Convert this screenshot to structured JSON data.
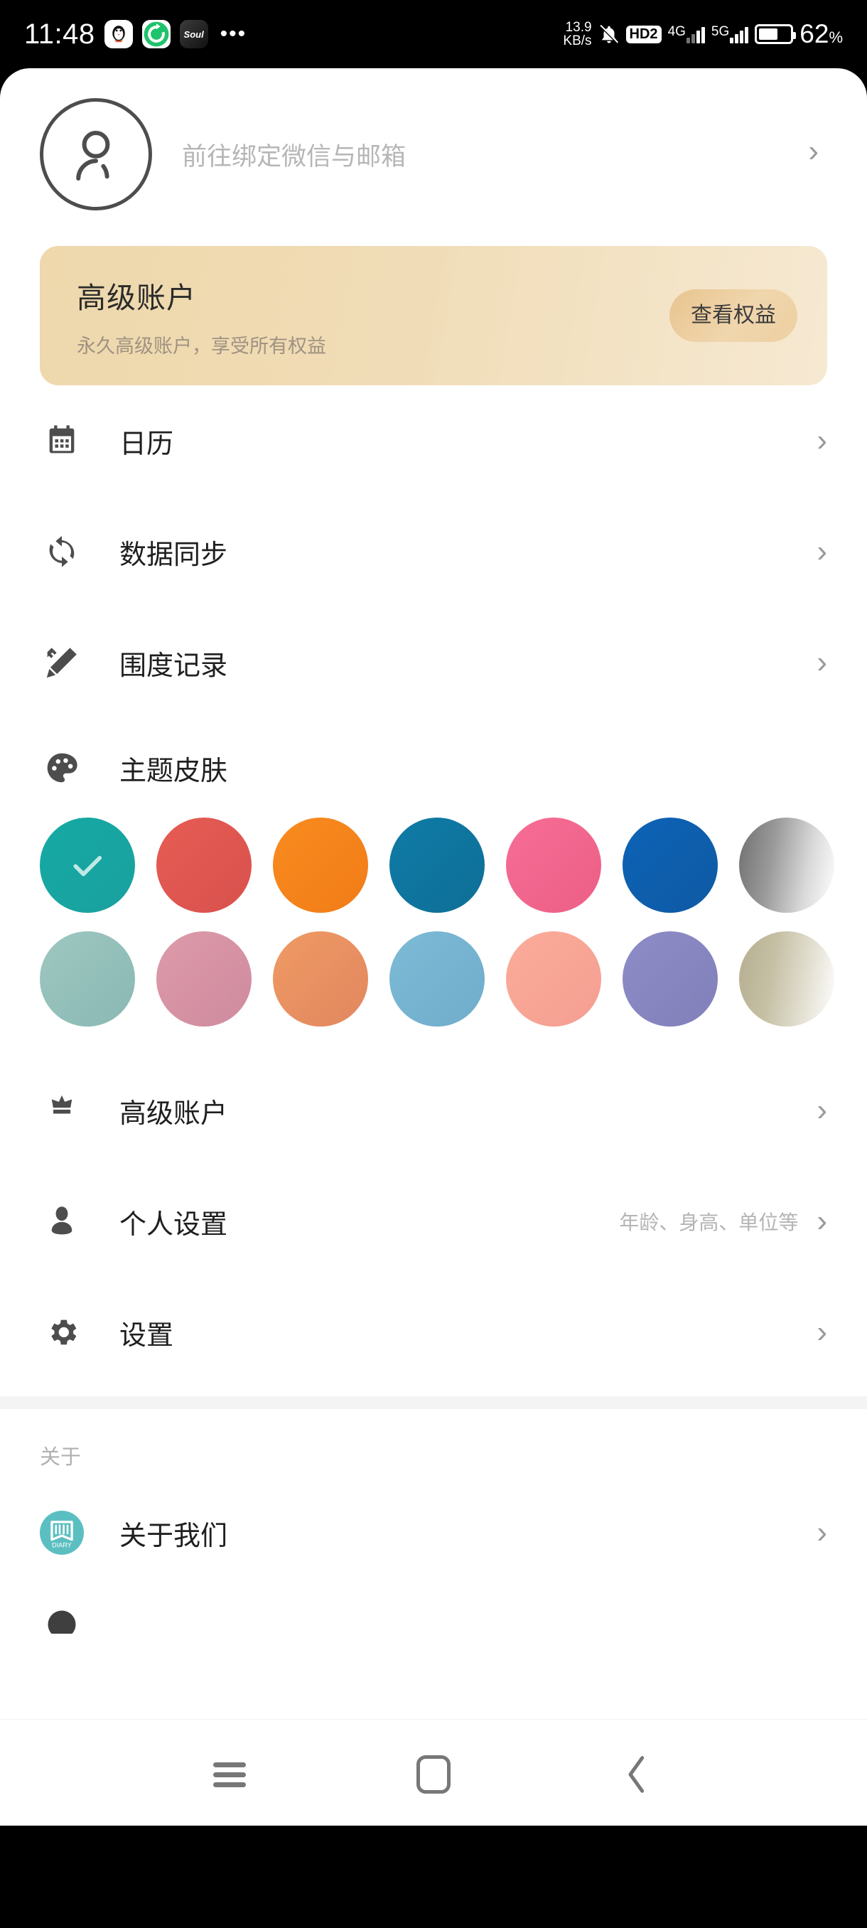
{
  "statusbar": {
    "time": "11:48",
    "app_icons": [
      "qq-icon",
      "sync-green-icon",
      "soul-icon"
    ],
    "soul_label": "Soul",
    "overflow": "•••",
    "network_speed_value": "13.9",
    "network_speed_unit": "KB/s",
    "mute_icon": "mute-bell-icon",
    "hd_badge": "HD2",
    "network_1": "4G",
    "network_2": "5G",
    "battery_percent": "62",
    "battery_unit": "%"
  },
  "profile": {
    "avatar_icon": "user-avatar-icon",
    "bind_text": "前往绑定微信与邮箱",
    "chevron": "›"
  },
  "premium_banner": {
    "title": "高级账户",
    "subtitle": "永久高级账户，享受所有权益",
    "button_label": "查看权益",
    "bg_color": "#EED8AC",
    "button_color": "#E8C48F"
  },
  "menu": [
    {
      "label": "日历",
      "icon": "calendar-icon",
      "hint": "",
      "chevron": "›"
    },
    {
      "label": "数据同步",
      "icon": "sync-icon",
      "hint": "",
      "chevron": "›"
    },
    {
      "label": "围度记录",
      "icon": "ruler-pencil-icon",
      "hint": "",
      "chevron": "›"
    },
    {
      "label": "主题皮肤",
      "icon": "palette-icon",
      "hint": "",
      "chevron": ""
    }
  ],
  "theme_swatches": {
    "selected_index": 0,
    "check_icon": "check-icon",
    "row1": [
      {
        "name": "teal",
        "color": "#14A5A5",
        "gradient": "linear-gradient(135deg,#16a9a4,#1aa19f)"
      },
      {
        "name": "red",
        "color": "#E05650",
        "gradient": "linear-gradient(135deg,#e65c54,#d9514d)"
      },
      {
        "name": "orange",
        "color": "#F58220",
        "gradient": "linear-gradient(135deg,#f88b1f,#f27c18)"
      },
      {
        "name": "blue-teal",
        "color": "#10749E",
        "gradient": "linear-gradient(135deg,#0f7ba6,#0e6f97)"
      },
      {
        "name": "pink",
        "color": "#F2688F",
        "gradient": "linear-gradient(135deg,#f66d95,#ec5f86)"
      },
      {
        "name": "strong-blue",
        "color": "#0E5FAE",
        "gradient": "linear-gradient(135deg,#0c63b6,#0f5aa4)"
      },
      {
        "name": "gray-fade",
        "color": "#8A8A8A",
        "gradient": "linear-gradient(100deg,#6f6f6f 0%,#9a9a9a 35%,#d9d9d9 70%,#ffffff 100%)"
      }
    ],
    "row2": [
      {
        "name": "muted-teal",
        "color": "#92BEBA",
        "gradient": "linear-gradient(135deg,#9ec7c0,#8ab8b4)"
      },
      {
        "name": "dusty-pink",
        "color": "#D691A4",
        "gradient": "linear-gradient(135deg,#dd9aa8,#cf8b9f)"
      },
      {
        "name": "soft-orange",
        "color": "#E89267",
        "gradient": "linear-gradient(135deg,#ef9a64,#e2875f)"
      },
      {
        "name": "light-blue",
        "color": "#76B3D1",
        "gradient": "linear-gradient(135deg,#7dbad6,#6fadcb)"
      },
      {
        "name": "salmon",
        "color": "#F7A696",
        "gradient": "linear-gradient(135deg,#fbac99,#f49e92)"
      },
      {
        "name": "periwinkle",
        "color": "#8786C0",
        "gradient": "linear-gradient(135deg,#8d8cc7,#8180b9)"
      },
      {
        "name": "khaki-fade",
        "color": "#BDB79C",
        "gradient": "linear-gradient(100deg,#b5ae90 0%,#c5bfa4 35%,#e4e1d3 70%,#ffffff 100%)"
      }
    ]
  },
  "menu2": [
    {
      "label": "高级账户",
      "icon": "crown-icon",
      "hint": "",
      "chevron": "›"
    },
    {
      "label": "个人设置",
      "icon": "person-icon",
      "hint": "年龄、身高、单位等",
      "chevron": "›"
    },
    {
      "label": "设置",
      "icon": "gear-icon",
      "hint": "",
      "chevron": "›"
    }
  ],
  "about": {
    "section_title": "关于",
    "items": [
      {
        "label": "关于我们",
        "icon": "diary-app-icon",
        "icon_text": "DIARY",
        "chevron": "›"
      }
    ]
  },
  "tabbar": {
    "active_index": 3,
    "active_color": "#14A5A5",
    "inactive_color": "#A6A6A6",
    "items": [
      {
        "name": "tab-home",
        "icon": "home-icon"
      },
      {
        "name": "tab-trend",
        "icon": "trend-circle-icon"
      },
      {
        "name": "tab-bookmark",
        "icon": "bookmark-icon"
      },
      {
        "name": "tab-profile",
        "icon": "person-icon"
      }
    ]
  },
  "navbar": {
    "recent": "recent-apps-icon",
    "home": "home-square-icon",
    "back": "back-chevron-icon"
  }
}
